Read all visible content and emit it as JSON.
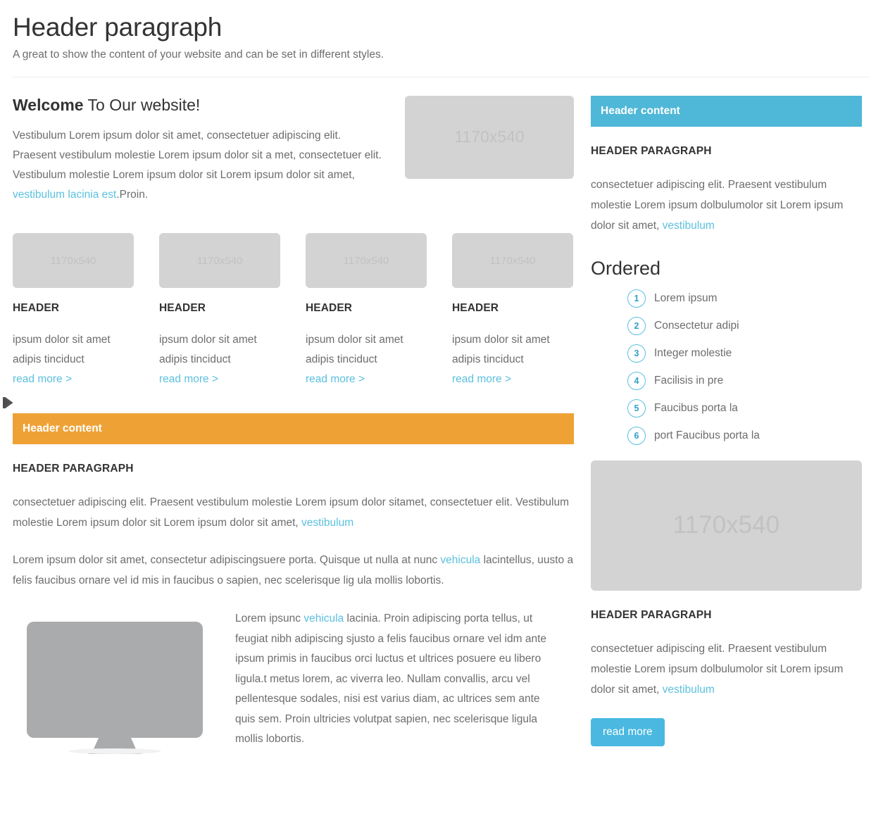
{
  "header": {
    "title": "Header paragraph",
    "subtitle": "A great to show the content of your website and can be set in different styles."
  },
  "welcome": {
    "title_bold": "Welcome",
    "title_rest": " To Our website!",
    "body_1": "Vestibulum Lorem ipsum dolor sit amet, consectetuer adipiscing elit. Praesent vestibulum molestie Lorem ipsum dolor sit a met, consectetuer elit. Vestibulum molestie Lorem ipsum dolor sit Lorem ipsum dolor sit amet, ",
    "body_link": "vestibulum lacinia est",
    "body_2": ".Proin.",
    "image_label": "1170x540"
  },
  "cards": [
    {
      "image_label": "1170x540",
      "title": "HEADER",
      "body": "ipsum dolor sit amet adipis tinciduct",
      "more": "read more >"
    },
    {
      "image_label": "1170x540",
      "title": "HEADER",
      "body": "ipsum dolor sit amet adipis tinciduct",
      "more": "read more >"
    },
    {
      "image_label": "1170x540",
      "title": "HEADER",
      "body": "ipsum dolor sit amet adipis tinciduct",
      "more": "read more >"
    },
    {
      "image_label": "1170x540",
      "title": "HEADER",
      "body": "ipsum dolor sit amet adipis tinciduct",
      "more": "read more >"
    }
  ],
  "main_panel": {
    "panel_header": "Header content",
    "section_header": "HEADER PARAGRAPH",
    "para_1": "consectetuer adipiscing elit. Praesent vestibulum molestie Lorem ipsum dolor sitamet, consectetuer elit. Vestibulum molestie Lorem ipsum dolor sit Lorem ipsum dolor sit amet, ",
    "para_1_link": "vestibulum",
    "para_2_a": "Lorem ipsum dolor sit amet, consectetur adipiscingsuere porta. Quisque ut nulla at nunc ",
    "para_2_link": "vehicula",
    "para_2_b": " lacintellus, uusto a felis faucibus ornare vel id mis in faucibus o sapien, nec scelerisque lig ula mollis lobortis.",
    "media_text_a": "Lorem ipsunc ",
    "media_text_link": "vehicula",
    "media_text_b": " lacinia. Proin adipiscing porta tellus, ut feugiat nibh adipiscing sjusto a felis faucibus ornare vel idm ante ipsum primis in faucibus orci luctus et ultrices posuere  eu libero ligula.t metus lorem, ac viverra leo. Nullam convallis, arcu vel pellentesque sodales, nisi est varius diam, ac ultrices sem ante quis sem. Proin ultricies volutpat sapien, nec scelerisque ligula mollis lobortis.",
    "monitor_icon": "monitor-icon"
  },
  "sidebar": {
    "panel_header": "Header content",
    "section_header": "HEADER PARAGRAPH",
    "para_1": "consectetuer adipiscing elit. Praesent vestibulum molestie Lorem ipsum dolbulumolor sit Lorem ipsum dolor sit amet, ",
    "para_1_link": "vestibulum",
    "ordered_title": "Ordered",
    "ordered_items": [
      {
        "num": "1",
        "label": "Lorem ipsum"
      },
      {
        "num": "2",
        "label": "Consectetur adipi"
      },
      {
        "num": "3",
        "label": "Integer molestie"
      },
      {
        "num": "4",
        "label": "Facilisis in pre"
      },
      {
        "num": "5",
        "label": "Faucibus porta la"
      },
      {
        "num": "6",
        "label": "port Faucibus porta la"
      }
    ],
    "image_label": "1170x540",
    "section_header_2": "HEADER PARAGRAPH",
    "para_2": "consectetuer adipiscing elit. Praesent vestibulum molestie Lorem ipsum dolbulumolor sit Lorem ipsum dolor sit amet, ",
    "para_2_link": "vestibulum",
    "button_label": "read more"
  },
  "cursor": {
    "icon": "chevron-right-icon"
  },
  "colors": {
    "accent_blue": "#5bc0de",
    "panel_blue": "#4fb7d7",
    "panel_orange": "#eea236",
    "button_blue": "#4ab8e0",
    "placeholder_gray": "#d3d3d3",
    "text_gray": "#6d6d6d",
    "heading_dark": "#333333"
  }
}
